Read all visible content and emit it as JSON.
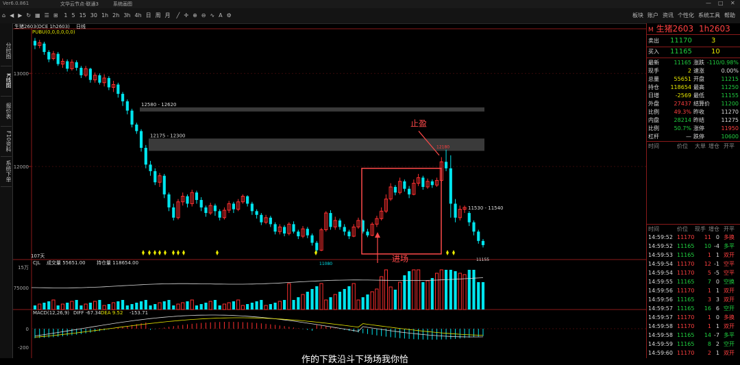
{
  "titlebar": {
    "app_name": "Ver6.0.861",
    "doc_title": "文华云节点-联通3",
    "mode": "系统画图"
  },
  "toolbar": {
    "periods": [
      "1",
      "5",
      "15",
      "30",
      "1h",
      "2h",
      "3h",
      "4h",
      "日",
      "周",
      "月"
    ],
    "right_menu": [
      "板块",
      "账户",
      "资讯",
      "个性化",
      "系统工具",
      "帮助"
    ]
  },
  "rail": {
    "tabs": [
      "分时图",
      "K线图",
      "报价表",
      "F10资料",
      "系统下单"
    ]
  },
  "chart_header": {
    "symbol": "生猪2603(DCE 1h2603)",
    "period": "日线",
    "indicator": "PUBU(0,0,0,0,0,0)"
  },
  "volume_header": {
    "name": "CJL",
    "vol_label": "成交量",
    "vol": "55651.00",
    "oi_label": "持仓量",
    "oi": "118654.00"
  },
  "macd_header": {
    "name": "MACD(12,26,9)",
    "diff_label": "DIFF",
    "diff": "-67.34",
    "dea_label": "DEA",
    "dea": "9.52",
    "macd": "-153.71"
  },
  "annotations": {
    "zone1": "12580 - 12620",
    "zone2": "12175 - 12300",
    "level": "11530 - 11540",
    "take_profit": "止盈",
    "entry": "进场",
    "high_mark": "12180",
    "low_mark": "11080",
    "last_mark": "11155",
    "days": "107天"
  },
  "bottom_caption": "作的下跌沿斗下场场我你恰",
  "colors": {
    "up": "#ff3030",
    "down": "#00e5ee",
    "zone": "#3a3a3a",
    "box": "#ff4a4a"
  },
  "chart_data": {
    "type": "candlestick",
    "y_ticks": [
      "13000",
      "12000"
    ],
    "vol_ticks": [
      "15万",
      "75000"
    ],
    "macd_ticks": [
      "0",
      "-200"
    ],
    "candles": [
      {
        "o": 13350,
        "c": 13300,
        "h": 13380,
        "l": 13260
      },
      {
        "o": 13300,
        "c": 13330,
        "h": 13360,
        "l": 13270
      },
      {
        "o": 13320,
        "c": 13230,
        "h": 13340,
        "l": 13200
      },
      {
        "o": 13230,
        "c": 13150,
        "h": 13250,
        "l": 13120
      },
      {
        "o": 13160,
        "c": 13210,
        "h": 13240,
        "l": 13140
      },
      {
        "o": 13210,
        "c": 13100,
        "h": 13230,
        "l": 13080
      },
      {
        "o": 13100,
        "c": 13130,
        "h": 13160,
        "l": 13060
      },
      {
        "o": 13130,
        "c": 13050,
        "h": 13150,
        "l": 13020
      },
      {
        "o": 13050,
        "c": 13120,
        "h": 13150,
        "l": 13030
      },
      {
        "o": 13120,
        "c": 13060,
        "h": 13140,
        "l": 13030
      },
      {
        "o": 13060,
        "c": 12980,
        "h": 13080,
        "l": 12950
      },
      {
        "o": 12980,
        "c": 13050,
        "h": 13080,
        "l": 12960
      },
      {
        "o": 13050,
        "c": 12930,
        "h": 13060,
        "l": 12900
      },
      {
        "o": 12930,
        "c": 12980,
        "h": 13010,
        "l": 12900
      },
      {
        "o": 12980,
        "c": 12900,
        "h": 13000,
        "l": 12880
      },
      {
        "o": 12900,
        "c": 12950,
        "h": 12990,
        "l": 12860
      },
      {
        "o": 12950,
        "c": 12850,
        "h": 12970,
        "l": 12820
      },
      {
        "o": 12850,
        "c": 12880,
        "h": 12920,
        "l": 12800
      },
      {
        "o": 12880,
        "c": 12780,
        "h": 12900,
        "l": 12740
      },
      {
        "o": 12780,
        "c": 12700,
        "h": 12800,
        "l": 12650
      },
      {
        "o": 12700,
        "c": 12600,
        "h": 12720,
        "l": 12560
      },
      {
        "o": 12600,
        "c": 12450,
        "h": 12620,
        "l": 12420
      },
      {
        "o": 12450,
        "c": 12380,
        "h": 12470,
        "l": 12350
      },
      {
        "o": 12380,
        "c": 12200,
        "h": 12400,
        "l": 12160
      },
      {
        "o": 12200,
        "c": 12020,
        "h": 12230,
        "l": 11980
      },
      {
        "o": 12020,
        "c": 11950,
        "h": 12060,
        "l": 11900
      },
      {
        "o": 11950,
        "c": 11830,
        "h": 11980,
        "l": 11800
      },
      {
        "o": 11830,
        "c": 11900,
        "h": 11930,
        "l": 11780
      },
      {
        "o": 11900,
        "c": 11700,
        "h": 11920,
        "l": 11660
      },
      {
        "o": 11700,
        "c": 11560,
        "h": 11720,
        "l": 11520
      },
      {
        "o": 11560,
        "c": 11450,
        "h": 11600,
        "l": 11420
      },
      {
        "o": 11450,
        "c": 11620,
        "h": 11650,
        "l": 11430
      },
      {
        "o": 11620,
        "c": 11680,
        "h": 11720,
        "l": 11580
      },
      {
        "o": 11680,
        "c": 11600,
        "h": 11700,
        "l": 11560
      },
      {
        "o": 11600,
        "c": 11720,
        "h": 11750,
        "l": 11570
      },
      {
        "o": 11720,
        "c": 11640,
        "h": 11740,
        "l": 11600
      },
      {
        "o": 11640,
        "c": 11560,
        "h": 11670,
        "l": 11520
      },
      {
        "o": 11560,
        "c": 11500,
        "h": 11580,
        "l": 11460
      },
      {
        "o": 11500,
        "c": 11580,
        "h": 11610,
        "l": 11480
      },
      {
        "o": 11580,
        "c": 11520,
        "h": 11600,
        "l": 11470
      },
      {
        "o": 11520,
        "c": 11450,
        "h": 11540,
        "l": 11420
      },
      {
        "o": 11450,
        "c": 11530,
        "h": 11560,
        "l": 11430
      },
      {
        "o": 11530,
        "c": 11600,
        "h": 11630,
        "l": 11500
      },
      {
        "o": 11600,
        "c": 11540,
        "h": 11620,
        "l": 11500
      },
      {
        "o": 11540,
        "c": 11620,
        "h": 11650,
        "l": 11520
      },
      {
        "o": 11620,
        "c": 11680,
        "h": 11700,
        "l": 11600
      },
      {
        "o": 11680,
        "c": 11600,
        "h": 11690,
        "l": 11570
      },
      {
        "o": 11600,
        "c": 11520,
        "h": 11620,
        "l": 11480
      },
      {
        "o": 11520,
        "c": 11480,
        "h": 11540,
        "l": 11440
      },
      {
        "o": 11480,
        "c": 11400,
        "h": 11500,
        "l": 11370
      },
      {
        "o": 11400,
        "c": 11450,
        "h": 11480,
        "l": 11380
      },
      {
        "o": 11450,
        "c": 11380,
        "h": 11470,
        "l": 11350
      },
      {
        "o": 11380,
        "c": 11300,
        "h": 11400,
        "l": 11270
      },
      {
        "o": 11300,
        "c": 11350,
        "h": 11380,
        "l": 11270
      },
      {
        "o": 11350,
        "c": 11280,
        "h": 11370,
        "l": 11250
      },
      {
        "o": 11280,
        "c": 11380,
        "h": 11400,
        "l": 11260
      },
      {
        "o": 11380,
        "c": 11300,
        "h": 11410,
        "l": 11280
      },
      {
        "o": 11300,
        "c": 11250,
        "h": 11320,
        "l": 11220
      },
      {
        "o": 11250,
        "c": 11330,
        "h": 11360,
        "l": 11230
      },
      {
        "o": 11330,
        "c": 11260,
        "h": 11350,
        "l": 11230
      },
      {
        "o": 11260,
        "c": 11180,
        "h": 11280,
        "l": 11150
      },
      {
        "o": 11180,
        "c": 11100,
        "h": 11200,
        "l": 11080
      },
      {
        "o": 11100,
        "c": 11320,
        "h": 11340,
        "l": 11090
      },
      {
        "o": 11320,
        "c": 11500,
        "h": 11520,
        "l": 11300
      },
      {
        "o": 11500,
        "c": 11350,
        "h": 11530,
        "l": 11320
      },
      {
        "o": 11350,
        "c": 11420,
        "h": 11460,
        "l": 11320
      },
      {
        "o": 11420,
        "c": 11350,
        "h": 11440,
        "l": 11320
      },
      {
        "o": 11350,
        "c": 11300,
        "h": 11380,
        "l": 11260
      },
      {
        "o": 11300,
        "c": 11250,
        "h": 11320,
        "l": 11220
      },
      {
        "o": 11250,
        "c": 11350,
        "h": 11380,
        "l": 11240
      },
      {
        "o": 11350,
        "c": 11420,
        "h": 11450,
        "l": 11330
      },
      {
        "o": 11420,
        "c": 11300,
        "h": 11430,
        "l": 11280
      },
      {
        "o": 11300,
        "c": 11260,
        "h": 11330,
        "l": 11240
      },
      {
        "o": 11260,
        "c": 11380,
        "h": 11400,
        "l": 11250
      },
      {
        "o": 11380,
        "c": 11440,
        "h": 11470,
        "l": 11350
      },
      {
        "o": 11440,
        "c": 11520,
        "h": 11560,
        "l": 11420
      },
      {
        "o": 11520,
        "c": 11650,
        "h": 11700,
        "l": 11500
      },
      {
        "o": 11650,
        "c": 11780,
        "h": 11820,
        "l": 11630
      },
      {
        "o": 11780,
        "c": 11720,
        "h": 11800,
        "l": 11690
      },
      {
        "o": 11720,
        "c": 11840,
        "h": 11880,
        "l": 11700
      },
      {
        "o": 11840,
        "c": 11760,
        "h": 11860,
        "l": 11730
      },
      {
        "o": 11760,
        "c": 11700,
        "h": 11790,
        "l": 11660
      },
      {
        "o": 11700,
        "c": 11820,
        "h": 11860,
        "l": 11690
      },
      {
        "o": 11820,
        "c": 11880,
        "h": 11920,
        "l": 11790
      },
      {
        "o": 11880,
        "c": 11780,
        "h": 11900,
        "l": 11750
      },
      {
        "o": 11780,
        "c": 11840,
        "h": 11870,
        "l": 11760
      },
      {
        "o": 11840,
        "c": 11800,
        "h": 11860,
        "l": 11770
      },
      {
        "o": 11800,
        "c": 11850,
        "h": 11880,
        "l": 11780
      },
      {
        "o": 11850,
        "c": 12050,
        "h": 12100,
        "l": 11830
      },
      {
        "o": 12050,
        "c": 11980,
        "h": 12180,
        "l": 11950
      },
      {
        "o": 11980,
        "c": 11600,
        "h": 12120,
        "l": 11450
      },
      {
        "o": 11600,
        "c": 11450,
        "h": 11650,
        "l": 11400
      },
      {
        "o": 11450,
        "c": 11540,
        "h": 11580,
        "l": 11420
      },
      {
        "o": 11540,
        "c": 11560,
        "h": 11580,
        "l": 11500
      },
      {
        "o": 11500,
        "c": 11400,
        "h": 11520,
        "l": 11360
      },
      {
        "o": 11400,
        "c": 11300,
        "h": 11420,
        "l": 11260
      },
      {
        "o": 11300,
        "c": 11200,
        "h": 11320,
        "l": 11170
      },
      {
        "o": 11200,
        "c": 11155,
        "h": 11220,
        "l": 11130
      }
    ]
  },
  "quote": {
    "symbol": "生猪2603",
    "code": "1h2603",
    "sell_label": "卖出",
    "sell_price": "11170",
    "sell_qty": "3",
    "buy_label": "买入",
    "buy_price": "11165",
    "buy_qty": "10",
    "rows": [
      {
        "l1": "最新",
        "v1": "11165",
        "c1": "grn",
        "l2": "涨跌",
        "v2": "-110/0.98%",
        "c2": "grn"
      },
      {
        "l1": "现手",
        "v1": "2",
        "c1": "yel",
        "l2": "速涨",
        "v2": "0.00%",
        "c2": "wht"
      },
      {
        "l1": "总量",
        "v1": "55651",
        "c1": "yel",
        "l2": "开盘",
        "v2": "11215",
        "c2": "grn"
      },
      {
        "l1": "持仓",
        "v1": "118654",
        "c1": "yel",
        "l2": "最高",
        "v2": "11250",
        "c2": "grn"
      },
      {
        "l1": "日增",
        "v1": "-2569",
        "c1": "yel",
        "l2": "最低",
        "v2": "11155",
        "c2": "grn"
      },
      {
        "l1": "外盘",
        "v1": "27437",
        "c1": "red",
        "l2": "结算价",
        "v2": "11200",
        "c2": "grn"
      },
      {
        "l1": "比例",
        "v1": "49.3%",
        "c1": "red",
        "l2": "昨收",
        "v2": "11270",
        "c2": "wht"
      },
      {
        "l1": "内盘",
        "v1": "28214",
        "c1": "grn",
        "l2": "昨结",
        "v2": "11275",
        "c2": "wht"
      },
      {
        "l1": "比例",
        "v1": "50.7%",
        "c1": "grn",
        "l2": "涨停",
        "v2": "11950",
        "c2": "red"
      },
      {
        "l1": "杠杆",
        "v1": "—",
        "c1": "wht",
        "l2": "跌停",
        "v2": "10600",
        "c2": "grn"
      }
    ],
    "tick_headers": [
      "时间",
      "价位",
      "大单",
      "增仓",
      "开平"
    ],
    "trade_headers": [
      "时间",
      "价位",
      "现手",
      "增仓",
      "开平"
    ],
    "trades": [
      {
        "t": "14:59:52",
        "p": "11170",
        "q": "11",
        "d": "0",
        "k": "多换",
        "kc": "red"
      },
      {
        "t": "14:59:52",
        "p": "11165",
        "q": "10",
        "d": "-4",
        "k": "多平",
        "kc": "grn"
      },
      {
        "t": "14:59:53",
        "p": "11165",
        "q": "1",
        "d": "1",
        "k": "双开",
        "kc": "red"
      },
      {
        "t": "14:59:54",
        "p": "11170",
        "q": "12",
        "d": "-1",
        "k": "空平",
        "kc": "red"
      },
      {
        "t": "14:59:54",
        "p": "11170",
        "q": "5",
        "d": "-5",
        "k": "空平",
        "kc": "red"
      },
      {
        "t": "14:59:55",
        "p": "11165",
        "q": "7",
        "d": "0",
        "k": "空换",
        "kc": "grn"
      },
      {
        "t": "14:59:56",
        "p": "11170",
        "q": "1",
        "d": "1",
        "k": "双开",
        "kc": "red"
      },
      {
        "t": "14:59:56",
        "p": "11165",
        "q": "3",
        "d": "3",
        "k": "双开",
        "kc": "red"
      },
      {
        "t": "14:59:57",
        "p": "11165",
        "q": "16",
        "d": "6",
        "k": "空开",
        "kc": "grn"
      },
      {
        "t": "14:59:57",
        "p": "11170",
        "q": "1",
        "d": "0",
        "k": "多换",
        "kc": "red"
      },
      {
        "t": "14:59:58",
        "p": "11170",
        "q": "1",
        "d": "1",
        "k": "双开",
        "kc": "red"
      },
      {
        "t": "14:59:58",
        "p": "11165",
        "q": "14",
        "d": "-7",
        "k": "多平",
        "kc": "grn"
      },
      {
        "t": "14:59:59",
        "p": "11165",
        "q": "8",
        "d": "2",
        "k": "空开",
        "kc": "grn"
      },
      {
        "t": "14:59:60",
        "p": "11170",
        "q": "2",
        "d": "1",
        "k": "双开",
        "kc": "red"
      }
    ]
  }
}
